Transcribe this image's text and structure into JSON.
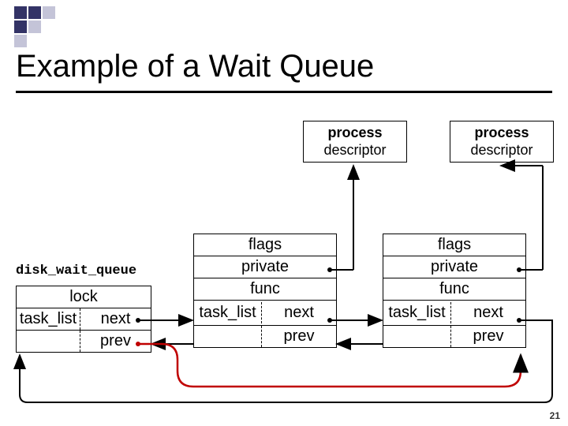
{
  "slide": {
    "title": "Example of a Wait Queue",
    "page_number": "21"
  },
  "descriptors": [
    {
      "line1": "process",
      "line2": "descriptor"
    },
    {
      "line1": "process",
      "line2": "descriptor"
    }
  ],
  "wait_queue_head": {
    "label": "disk_wait_queue",
    "lock": "lock",
    "task_list": "task_list",
    "next": "next",
    "prev": "prev"
  },
  "nodes": [
    {
      "flags": "flags",
      "private": "private",
      "func": "func",
      "task_list": "task_list",
      "next": "next",
      "prev": "prev"
    },
    {
      "flags": "flags",
      "private": "private",
      "func": "func",
      "task_list": "task_list",
      "next": "next",
      "prev": "prev"
    }
  ],
  "chart_data": {
    "type": "diagram",
    "title": "Example of a Wait Queue",
    "structure": "doubly linked list (wait queue)",
    "head": {
      "name": "disk_wait_queue",
      "fields": [
        "lock",
        "task_list.next",
        "task_list.prev"
      ]
    },
    "element_fields": [
      "flags",
      "private",
      "func",
      "task_list.next",
      "task_list.prev"
    ],
    "elements": 2,
    "pointers": [
      {
        "from": "head.next",
        "to": "node1"
      },
      {
        "from": "node1.next",
        "to": "node2"
      },
      {
        "from": "node2.next",
        "to": "head",
        "note": "wraps back"
      },
      {
        "from": "head.prev",
        "to": "node2",
        "note": "wraps"
      },
      {
        "from": "node1.prev",
        "to": "head"
      },
      {
        "from": "node2.prev",
        "to": "node1"
      },
      {
        "from": "node1.private",
        "to": "process descriptor 1"
      },
      {
        "from": "node2.private",
        "to": "process descriptor 2"
      }
    ]
  }
}
